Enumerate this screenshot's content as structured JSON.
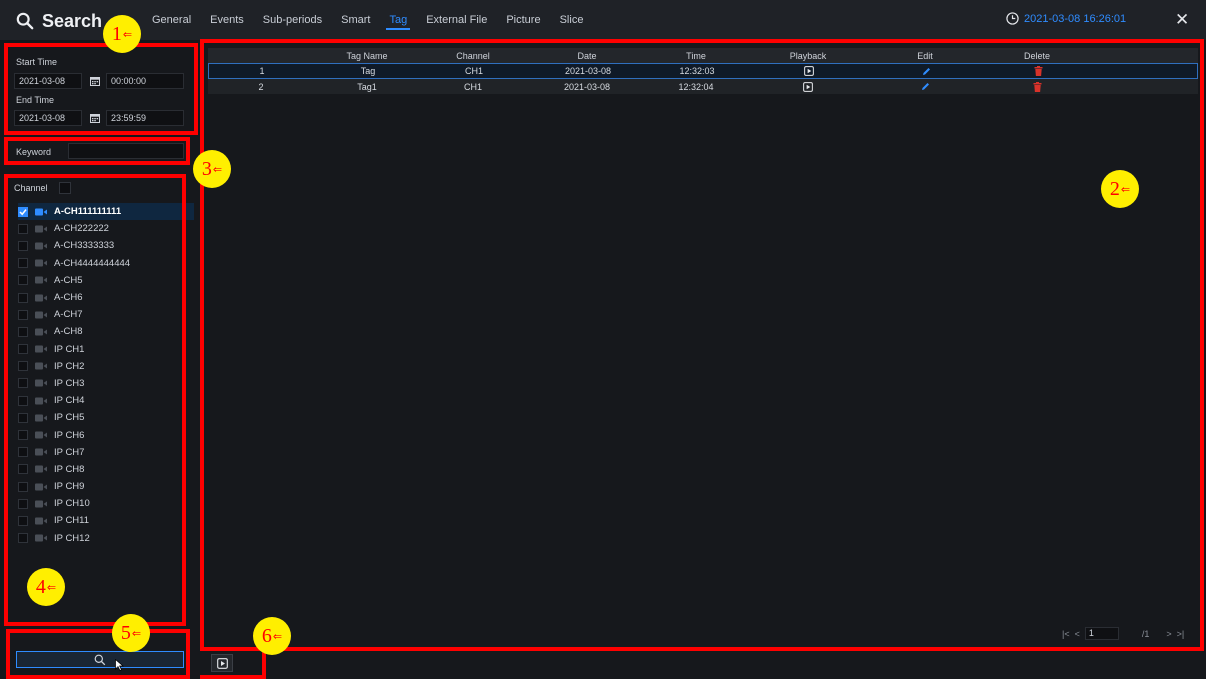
{
  "header": {
    "title": "Search",
    "tabs": [
      "General",
      "Events",
      "Sub-periods",
      "Smart",
      "Tag",
      "External File",
      "Picture",
      "Slice"
    ],
    "active_tab": "Tag",
    "datetime": "2021-03-08 16:26:01",
    "close_glyph": "✕"
  },
  "filters": {
    "start_label": "Start Time",
    "start_date": "2021-03-08",
    "start_time": "00:00:00",
    "end_label": "End Time",
    "end_date": "2021-03-08",
    "end_time": "23:59:59",
    "keyword_label": "Keyword",
    "keyword_value": ""
  },
  "channels": {
    "label": "Channel",
    "items": [
      {
        "name": "A-CH111111111",
        "checked": true
      },
      {
        "name": "A-CH222222",
        "checked": false
      },
      {
        "name": "A-CH3333333",
        "checked": false
      },
      {
        "name": "A-CH4444444444",
        "checked": false
      },
      {
        "name": "A-CH5",
        "checked": false
      },
      {
        "name": "A-CH6",
        "checked": false
      },
      {
        "name": "A-CH7",
        "checked": false
      },
      {
        "name": "A-CH8",
        "checked": false
      },
      {
        "name": "IP CH1",
        "checked": false
      },
      {
        "name": "IP CH2",
        "checked": false
      },
      {
        "name": "IP CH3",
        "checked": false
      },
      {
        "name": "IP CH4",
        "checked": false
      },
      {
        "name": "IP CH5",
        "checked": false
      },
      {
        "name": "IP CH6",
        "checked": false
      },
      {
        "name": "IP CH7",
        "checked": false
      },
      {
        "name": "IP CH8",
        "checked": false
      },
      {
        "name": "IP CH9",
        "checked": false
      },
      {
        "name": "IP CH10",
        "checked": false
      },
      {
        "name": "IP CH11",
        "checked": false
      },
      {
        "name": "IP CH12",
        "checked": false
      }
    ]
  },
  "table": {
    "columns": [
      "",
      "Tag Name",
      "Channel",
      "Date",
      "Time",
      "Playback",
      "Edit",
      "Delete"
    ],
    "rows": [
      {
        "no": "1",
        "tag": "Tag",
        "channel": "CH1",
        "date": "2021-03-08",
        "time": "12:32:03"
      },
      {
        "no": "2",
        "tag": "Tag1",
        "channel": "CH1",
        "date": "2021-03-08",
        "time": "12:32:04"
      }
    ]
  },
  "pagination": {
    "current": "1",
    "total": "/1"
  },
  "annotations": [
    "1",
    "2",
    "3",
    "4",
    "5",
    "6"
  ],
  "colors": {
    "accent": "#2f8cff",
    "annotation": "#ff0000",
    "bubble": "#ffef00",
    "delete": "#d8322a"
  },
  "icons": [
    "search-icon",
    "clock-icon",
    "close-icon",
    "calendar-icon",
    "camera-icon",
    "play-icon",
    "edit-icon",
    "trash-icon",
    "first-page-icon",
    "prev-page-icon",
    "next-page-icon",
    "last-page-icon"
  ]
}
